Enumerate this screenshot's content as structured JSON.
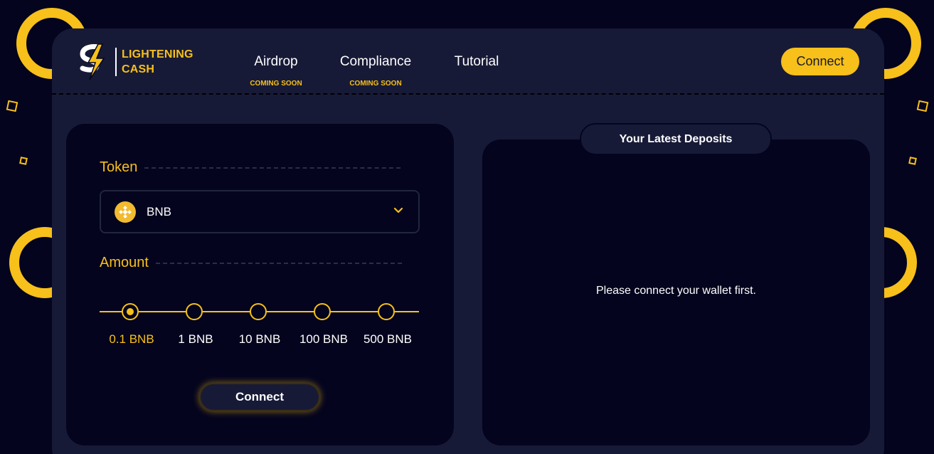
{
  "brand": {
    "line1": "LIGHTENING",
    "line2": "CASH",
    "accent": "#f7c01a"
  },
  "nav": [
    {
      "label": "Airdrop",
      "sub": "COMING SOON"
    },
    {
      "label": "Compliance",
      "sub": "COMING SOON"
    },
    {
      "label": "Tutorial",
      "sub": ""
    }
  ],
  "header": {
    "connect_label": "Connect"
  },
  "deposit": {
    "token_title": "Token",
    "token": {
      "name": "BNB",
      "icon": "bnb-icon"
    },
    "amount_title": "Amount",
    "amounts": [
      "0.1 BNB",
      "1 BNB",
      "10 BNB",
      "100 BNB",
      "500 BNB"
    ],
    "selected_amount": "0.1 BNB",
    "connect_label": "Connect"
  },
  "deposits_panel": {
    "tab_label": "Your Latest Deposits",
    "empty_message": "Please connect your wallet first."
  }
}
